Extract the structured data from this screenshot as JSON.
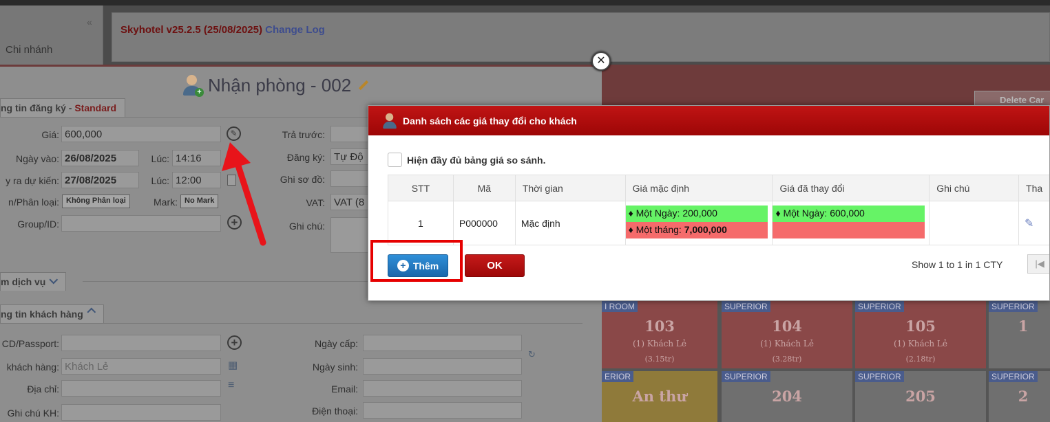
{
  "app": {
    "collapse_glyph": "«",
    "branch_label": "Chi nhánh",
    "version": "Skyhotel v25.2.5 (25/08/2025)",
    "changelog": "Change Log",
    "delete_button": "Delete Car"
  },
  "checkin": {
    "title": "Nhận phòng - 002",
    "section_registration": "ng tin đăng ký",
    "registration_sep": " - ",
    "registration_type": "Standard",
    "price_label": "Giá:",
    "price_value": "600,000",
    "checkin_label": "Ngày vào:",
    "checkin_date": "26/08/2025",
    "time_label_1": "Lúc:",
    "checkin_time": "14:16",
    "checkout_label": "y ra dự kiến:",
    "checkout_date": "27/08/2025",
    "time_label_2": "Lúc:",
    "checkout_time": "12:00",
    "category_label": "n/Phân loại:",
    "category_value": "Không Phân loại",
    "mark_label": "Mark:",
    "mark_value": "No Mark",
    "group_label": "Group/ID:",
    "prepaid_label": "Trả trước:",
    "register_label": "Đăng ký:",
    "register_value": "Tự Độ",
    "diagram_label": "Ghi sơ đồ:",
    "vat_label": "VAT:",
    "vat_value": "VAT (8",
    "note_label": "Ghi chú:",
    "section_services": "m dịch vụ",
    "section_customer": "ng tin khách hàng",
    "passport_label": "CD/Passport:",
    "customer_label": "khách hàng:",
    "customer_placeholder": "Khách Lẻ",
    "address_label": "Địa chỉ:",
    "customer_note_label": "Ghi chú KH:",
    "issue_date_label": "Ngày cấp:",
    "birth_label": "Ngày sinh:",
    "email_label": "Email:",
    "phone_label": "Điện thoại:"
  },
  "modal": {
    "title": "Danh sách các giá thay đổi cho khách",
    "show_full_label": "Hiện đầy đủ bảng giá so sánh.",
    "columns": [
      "STT",
      "Mã",
      "Thời gian",
      "Giá mặc định",
      "Giá đã thay đổi",
      "Ghi chú",
      "Tha"
    ],
    "rows": [
      {
        "stt": "1",
        "code": "P000000",
        "time": "Mặc định",
        "default_day_label": "♦ Một Ngày: ",
        "default_day_value": "200,000",
        "default_month_label": "♦ Một tháng: ",
        "default_month_value": "7,000,000",
        "changed_day_label": "♦ Một Ngày: ",
        "changed_day_value": "600,000",
        "note": ""
      }
    ],
    "add_button": "Thêm",
    "ok_button": "OK",
    "pager_text": "Show 1 to 1 in 1 CTY"
  },
  "rooms": [
    {
      "tag": "I ROOM",
      "number": "103",
      "guest": "(1) Khách Lẻ",
      "price": "(3.15tr)",
      "color": "#8a4848"
    },
    {
      "tag": "SUPERIOR",
      "number": "104",
      "guest": "(1) Khách Lẻ",
      "price": "(3.28tr)",
      "color": "#8a4848"
    },
    {
      "tag": "SUPERIOR",
      "number": "105",
      "guest": "(1) Khách Lẻ",
      "price": "(2.18tr)",
      "color": "#8a4848"
    },
    {
      "tag": "SUPERIOR",
      "number": "1",
      "guest": "",
      "price": "",
      "color": "#6f6f6f"
    },
    {
      "tag": "ERIOR",
      "number": "An thư",
      "guest": "",
      "price": "",
      "color": "#8f7a3a"
    },
    {
      "tag": "SUPERIOR",
      "number": "204",
      "guest": "",
      "price": "",
      "color": "#6f6f6f"
    },
    {
      "tag": "SUPERIOR",
      "number": "205",
      "guest": "",
      "price": "",
      "color": "#6f6f6f"
    },
    {
      "tag": "SUPERIOR",
      "number": "2",
      "guest": "",
      "price": "",
      "color": "#6f6f6f"
    }
  ],
  "colors": {
    "modal_header": "#b00e0e",
    "default_price_green": "#66f366",
    "month_price_red": "#f56b6b",
    "add_button": "#1f74bd",
    "highlight": "#e60000"
  }
}
